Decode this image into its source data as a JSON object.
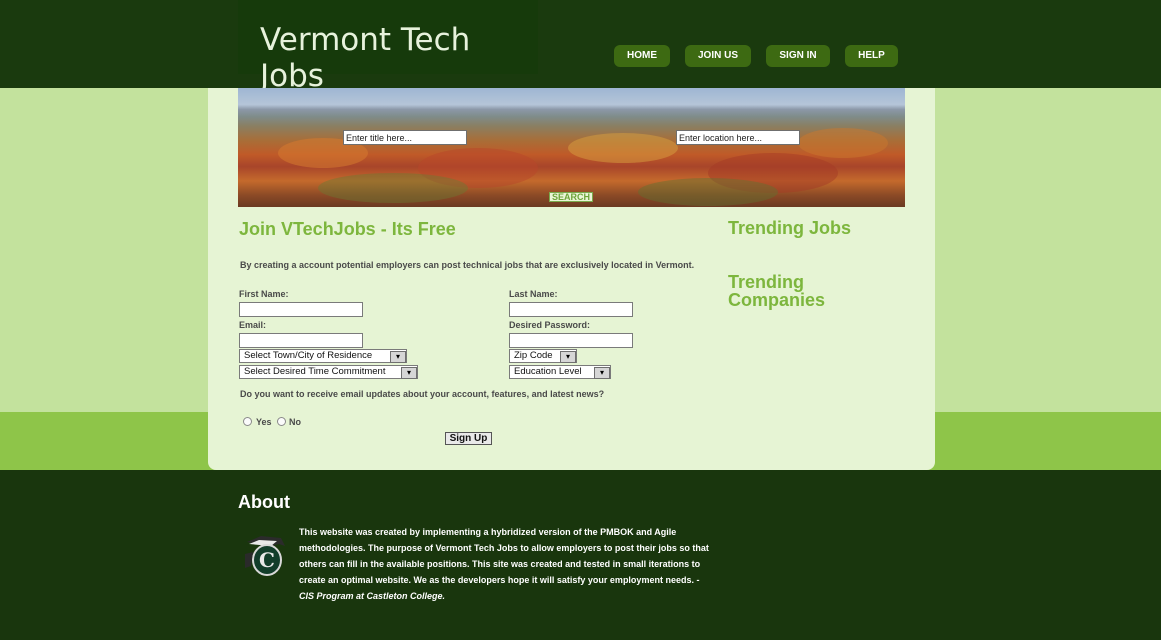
{
  "site": {
    "title": "Vermont Tech Jobs"
  },
  "nav": {
    "home": "HOME",
    "join": "JOIN US",
    "signin": "SIGN IN",
    "help": "HELP"
  },
  "search": {
    "title_placeholder": "Enter title here...",
    "location_placeholder": "Enter location here...",
    "button": "SEARCH"
  },
  "signup_form": {
    "heading": "Join VTechJobs - Its Free",
    "intro": "By creating a account potential employers can post technical jobs that are exclusively located in Vermont.",
    "first_name_label": "First Name:",
    "last_name_label": "Last Name:",
    "email_label": "Email:",
    "password_label": "Desired Password:",
    "town_select": "Select Town/City of Residence",
    "zip_select": "Zip Code",
    "time_select": "Select Desired Time Commitment",
    "education_select": "Education Level",
    "email_updates_question": "Do you want to receive email updates about your account, features, and latest news?",
    "yes_label": "Yes",
    "no_label": "No",
    "submit": "Sign Up"
  },
  "sidebar": {
    "trending_jobs": "Trending Jobs",
    "trending_companies_line1": "Trending",
    "trending_companies_line2": "Companies"
  },
  "about": {
    "heading": "About",
    "body": "This website was created by implementing a hybridized version of the PMBOK and Agile methodologies. The purpose of Vermont Tech Jobs to allow employers to post their jobs so that others can fill in the available positions. This site was created and tested in small iterations to create an optimal website. We as the developers hope it will satisfy your employment needs. -",
    "credit": "CIS Program at Castleton College."
  },
  "colors": {
    "header_bg": "#1a3a0e",
    "nav_button": "#3d6a12",
    "accent_green": "#7db63d",
    "content_bg": "#e6f4d4",
    "light_band": "#c3e29d",
    "mid_band": "#8ec549"
  },
  "icons": {
    "emblem": "castleton-spartan-emblem"
  }
}
